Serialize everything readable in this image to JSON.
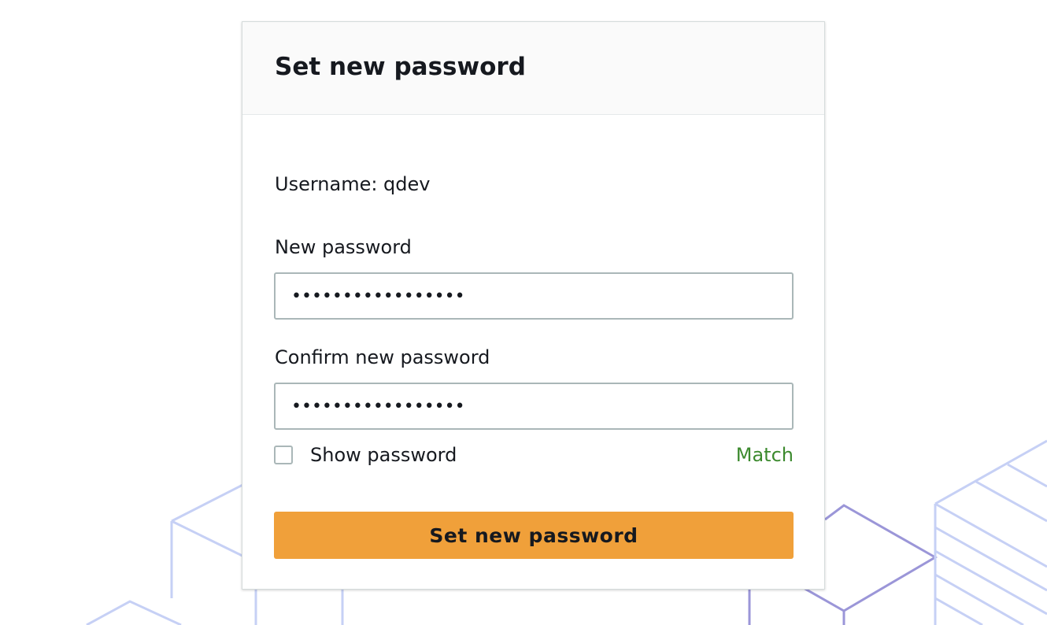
{
  "card": {
    "title": "Set new password"
  },
  "form": {
    "username_line": "Username: qdev",
    "new_password_label": "New password",
    "new_password_value": "•••••••••••••••••",
    "confirm_password_label": "Confirm new password",
    "confirm_password_value": "•••••••••••••••••",
    "show_password_label": "Show password",
    "show_password_checked": false,
    "match_status": "Match",
    "submit_label": "Set new password"
  },
  "colors": {
    "accent_button": "#f0a03a",
    "match_green": "#3c8a2e",
    "background_art": "#c9d3f2"
  }
}
